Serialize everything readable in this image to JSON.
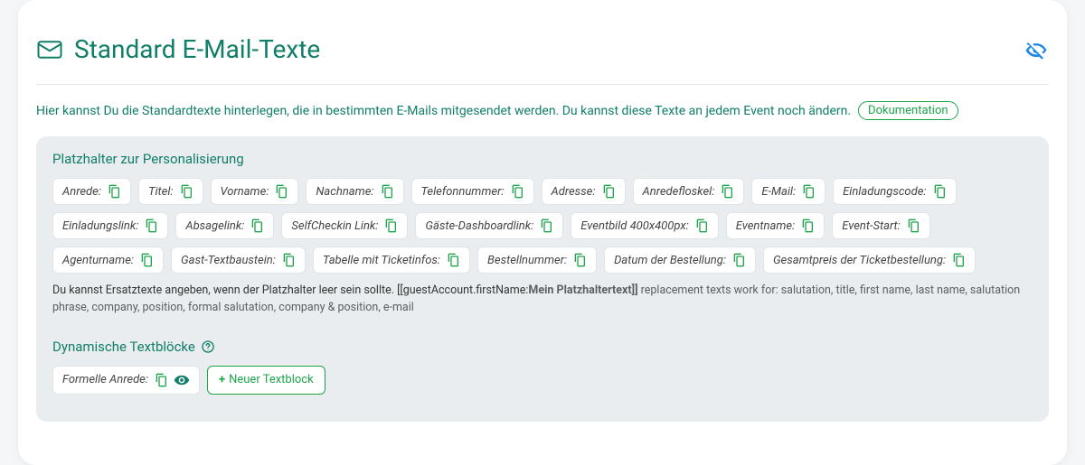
{
  "title": "Standard E-Mail-Texte",
  "intro_text": "Hier kannst Du die Standardtexte hinterlegen, die in bestimmten E-Mails mitgesendet werden. Du kannst diese Texte an jedem Event noch ändern.",
  "doc_link_label": "Dokumentation",
  "panel_heading": "Platzhalter zur Personalisierung",
  "placeholders": [
    {
      "label": "Anrede:"
    },
    {
      "label": "Titel:"
    },
    {
      "label": "Vorname:"
    },
    {
      "label": "Nachname:"
    },
    {
      "label": "Telefonnummer:"
    },
    {
      "label": "Adresse:"
    },
    {
      "label": "Anredefloskel:"
    },
    {
      "label": "E-Mail:"
    },
    {
      "label": "Einladungscode:"
    },
    {
      "label": "Einladungslink:"
    },
    {
      "label": "Absagelink:"
    },
    {
      "label": "SelfCheckin Link:"
    },
    {
      "label": "Gäste-Dashboardlink:"
    },
    {
      "label": "Eventbild 400x400px:"
    },
    {
      "label": "Eventname:"
    },
    {
      "label": "Event-Start:"
    },
    {
      "label": "Agenturname:"
    },
    {
      "label": "Gast-Textbaustein:"
    },
    {
      "label": "Tabelle mit Ticketinfos:"
    },
    {
      "label": "Bestellnummer:"
    },
    {
      "label": "Datum der Bestellung:"
    },
    {
      "label": "Gesamtpreis der Ticketbestellung:"
    }
  ],
  "help_lead": "Du kannst Ersatztexte angeben, wenn der Platzhalter leer sein sollte. [[guestAccount.firstName:",
  "help_bold": "Mein Platzhaltertext]]",
  "help_rest": " replacement texts work for: salutation, title, first name, last name, salutation phrase, company, position, formal salutation, company & position, e-mail",
  "subheading": "Dynamische Textblöcke",
  "textblocks": [
    {
      "label": "Formelle Anrede:"
    }
  ],
  "add_button_label": "Neuer Textblock"
}
